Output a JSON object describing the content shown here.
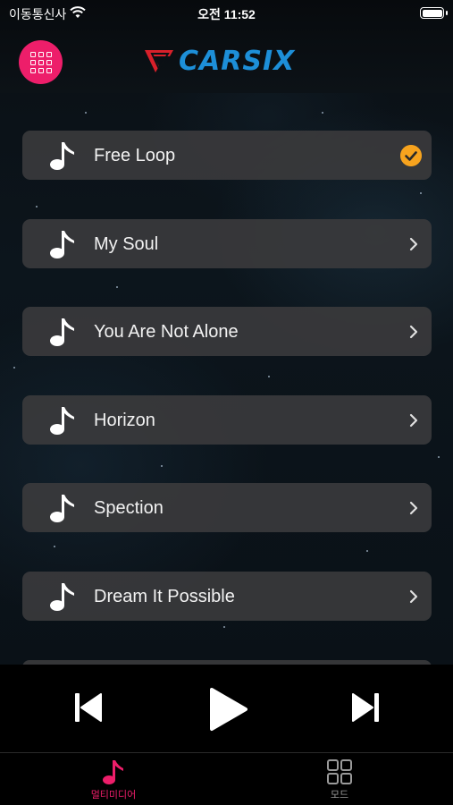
{
  "status_bar": {
    "carrier": "이동통신사",
    "time": "오전 11:52",
    "icons": [
      "wifi-icon",
      "battery-icon"
    ]
  },
  "header": {
    "brand": "CARSIX",
    "menu_icon": "grid-menu-icon",
    "accent_color": "#ed1e6a",
    "brand_color": "#1d8fd8"
  },
  "tracks": [
    {
      "title": "Free Loop",
      "selected": true
    },
    {
      "title": "My Soul",
      "selected": false
    },
    {
      "title": "You Are Not Alone",
      "selected": false
    },
    {
      "title": "Horizon",
      "selected": false
    },
    {
      "title": "Spection",
      "selected": false
    },
    {
      "title": "Dream It Possible",
      "selected": false
    }
  ],
  "player": {
    "icons": [
      "previous-track-icon",
      "play-icon",
      "next-track-icon"
    ]
  },
  "tabbar": {
    "tabs": [
      {
        "label": "멀티미디어",
        "icon": "music-note-icon",
        "active": true
      },
      {
        "label": "모드",
        "icon": "grid-squares-icon",
        "active": false
      }
    ]
  },
  "colors": {
    "selected_check": "#f7a31e",
    "row_background": "#3a3a3c"
  }
}
